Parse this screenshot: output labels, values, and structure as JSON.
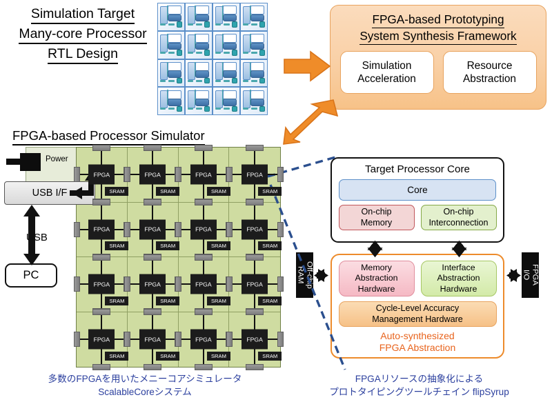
{
  "simulation_target": {
    "line1": "Simulation Target",
    "line2": "Many-core Processor",
    "line3": "RTL Design",
    "chip_icon": "manycore-chip-grid",
    "grid_rows": 4,
    "grid_cols": 4
  },
  "framework": {
    "title_line1": "FPGA-based Prototyping",
    "title_line2": "System Synthesis Framework",
    "boxes": [
      {
        "label": "Simulation\nAcceleration"
      },
      {
        "label": "Resource\nAbstraction"
      }
    ],
    "panel_color": "#f7c288",
    "border_color": "#e8a35e"
  },
  "arrows": {
    "right_arrow": "arrow-right-icon",
    "diagonal_arrow": "arrow-down-left-icon",
    "arrow_color": "#ed8b2b"
  },
  "simulator": {
    "title": "FPGA-based Processor Simulator",
    "power_label": "Power",
    "usb_if_label": "USB I/F",
    "usb_label": "USB",
    "pc_label": "PC",
    "board_color": "#cfdca1",
    "fpga_label": "FPGA",
    "sram_label": "SRAM",
    "grid_rows": 4,
    "grid_cols": 4
  },
  "target_core": {
    "title": "Target Processor Core",
    "core_label": "Core",
    "onchip_memory": "On-chip\nMemory",
    "onchip_interconnection": "On-chip\nInterconnection",
    "core_color": "#d7e3f3",
    "memory_color": "#f3d6d6",
    "interconnect_color": "#e3f0cd"
  },
  "abstraction": {
    "memory_abstraction": "Memory\nAbstraction\nHardware",
    "interface_abstraction": "Interface\nAbstraction\nHardware",
    "cycle_level": "Cycle-Level Accuracy\nManagement Hardware",
    "caption_line1": "Auto-synthesized",
    "caption_line2": "FPGA Abstraction",
    "caption_color": "#e8631c",
    "border_color": "#ed8b2b"
  },
  "side_blocks": {
    "offchip_ram": "Off-chip\nRAM",
    "fpga_io": "FPGA\nI/O"
  },
  "captions": {
    "left": "多数のFPGAを用いたメニーコアシミュレータ\nScalableCoreシステム",
    "right": "FPGAリソースの抽象化による\nプロトタイピングツールチェイン flipSyrup",
    "color": "#2b3f9e"
  }
}
